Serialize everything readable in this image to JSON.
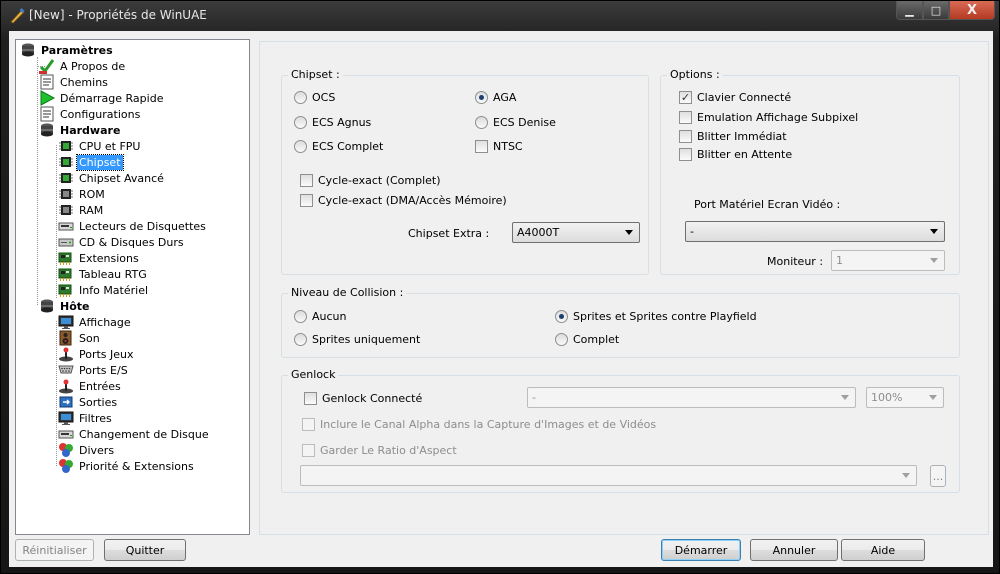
{
  "window": {
    "title": "[New] - Propriétés de WinUAE",
    "minimize_glyph": "▁",
    "maximize_glyph": "□",
    "close_glyph": "X"
  },
  "tree": {
    "items": [
      {
        "label": "Paramètres",
        "icon": "disk-stack-icon"
      },
      {
        "label": "A Propos de",
        "icon": "checkmark-icon"
      },
      {
        "label": "Chemins",
        "icon": "document-icon"
      },
      {
        "label": "Démarrage Rapide",
        "icon": "play-icon"
      },
      {
        "label": "Configurations",
        "icon": "document-icon"
      },
      {
        "label": "Hardware",
        "icon": "disk-stack-icon"
      },
      {
        "label": "CPU et FPU",
        "icon": "chip-icon"
      },
      {
        "label": "Chipset",
        "icon": "chip-icon"
      },
      {
        "label": "Chipset Avancé",
        "icon": "chip-icon"
      },
      {
        "label": "ROM",
        "icon": "chip-icon"
      },
      {
        "label": "RAM",
        "icon": "chip-icon"
      },
      {
        "label": "Lecteurs de Disquettes",
        "icon": "floppy-drive-icon"
      },
      {
        "label": "CD & Disques Durs",
        "icon": "hard-disk-icon"
      },
      {
        "label": "Extensions",
        "icon": "expansion-card-icon"
      },
      {
        "label": "Tableau RTG",
        "icon": "expansion-card-icon"
      },
      {
        "label": "Info Matériel",
        "icon": "expansion-card-icon"
      },
      {
        "label": "Hôte",
        "icon": "disk-stack-icon"
      },
      {
        "label": "Affichage",
        "icon": "monitor-icon"
      },
      {
        "label": "Son",
        "icon": "speaker-icon"
      },
      {
        "label": "Ports Jeux",
        "icon": "joystick-icon"
      },
      {
        "label": "Ports E/S",
        "icon": "port-icon"
      },
      {
        "label": "Entrées",
        "icon": "joystick-icon"
      },
      {
        "label": "Sorties",
        "icon": "output-icon"
      },
      {
        "label": "Filtres",
        "icon": "monitor-icon"
      },
      {
        "label": "Changement de Disque",
        "icon": "floppy-drive-icon"
      },
      {
        "label": "Divers",
        "icon": "misc-icon"
      },
      {
        "label": "Priorité & Extensions",
        "icon": "misc-icon"
      }
    ]
  },
  "chipset": {
    "title": "Chipset :",
    "ocs": "OCS",
    "aga": "AGA",
    "ecs_agnus": "ECS Agnus",
    "ecs_denise": "ECS Denise",
    "ecs_complet": "ECS Complet",
    "ntsc": "NTSC",
    "cycle_exact_complet": "Cycle-exact (Complet)",
    "cycle_exact_dma": "Cycle-exact (DMA/Accès Mémoire)",
    "extra_label": "Chipset Extra :",
    "extra_value": "A4000T"
  },
  "options": {
    "title": "Options :",
    "clavier": "Clavier Connecté",
    "emulation": "Emulation Affichage Subpixel",
    "blitter_immediat": "Blitter Immédiat",
    "blitter_attente": "Blitter en Attente",
    "port_label": "Port Matériel Ecran Vidéo :",
    "port_value": "-",
    "moniteur_label": "Moniteur :",
    "moniteur_value": "1",
    "check_glyph": "✓"
  },
  "collision": {
    "title": "Niveau de Collision :",
    "aucun": "Aucun",
    "sprites_playfield": "Sprites et Sprites contre Playfield",
    "sprites_uniquement": "Sprites uniquement",
    "complet": "Complet"
  },
  "genlock": {
    "title": "Genlock",
    "connecte": "Genlock Connecté",
    "mode_value": "-",
    "percent_value": "100%",
    "alpha": "Inclure le Canal Alpha dans la Capture d'Images et de Vidéos",
    "ratio": "Garder Le Ratio d'Aspect",
    "file_value": "",
    "browse_label": "..."
  },
  "buttons": {
    "reinitialiser": "Réinitialiser",
    "quitter": "Quitter",
    "demarrer": "Démarrer",
    "annuler": "Annuler",
    "aide": "Aide"
  }
}
